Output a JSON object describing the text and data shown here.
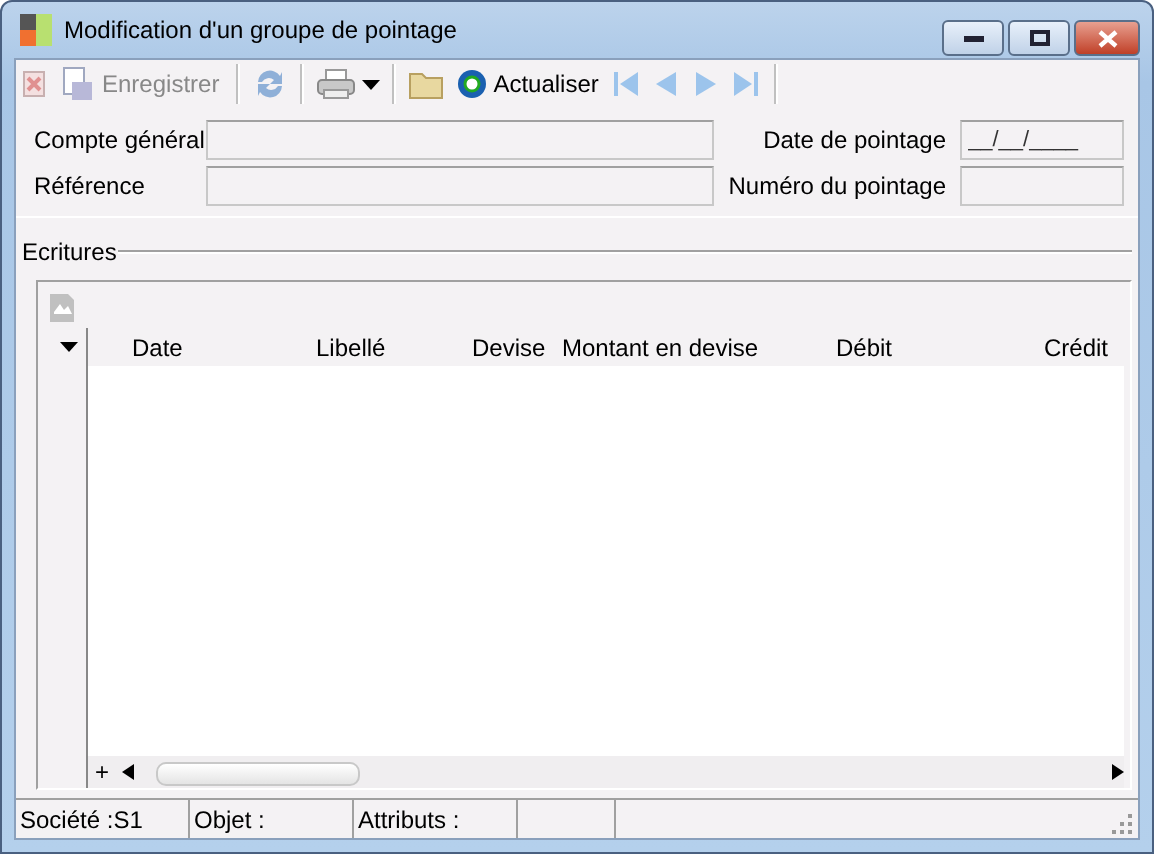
{
  "window": {
    "title": "Modification d'un groupe de pointage"
  },
  "toolbar": [
    {
      "kind": "delete",
      "disabled": true
    },
    {
      "kind": "save",
      "label": "Enregistrer",
      "disabled": true
    },
    {
      "kind": "separator"
    },
    {
      "kind": "sync",
      "disabled": true
    },
    {
      "kind": "separator"
    },
    {
      "kind": "print",
      "disabled": true
    },
    {
      "kind": "separator"
    },
    {
      "kind": "folder",
      "disabled": false
    },
    {
      "kind": "refresh",
      "label": "Actualiser",
      "disabled": false
    },
    {
      "kind": "first",
      "disabled": true
    },
    {
      "kind": "prev",
      "disabled": true
    },
    {
      "kind": "next",
      "disabled": true
    },
    {
      "kind": "last",
      "disabled": true
    },
    {
      "kind": "separator"
    }
  ],
  "form": {
    "left": [
      {
        "label": "Compte général"
      },
      {
        "label": "Référence"
      }
    ],
    "right": [
      {
        "label": "Date de pointage",
        "value": "__/__/____"
      },
      {
        "label": "Numéro du pointage"
      }
    ]
  },
  "ecritures": {
    "title": "Ecritures",
    "columns": [
      "Date",
      "Libellé",
      "Devise",
      "Montant en devise",
      "Débit",
      "Crédit"
    ],
    "add": "+"
  },
  "status_bar": [
    "Société :S1",
    "Objet :",
    "Attributs :"
  ]
}
